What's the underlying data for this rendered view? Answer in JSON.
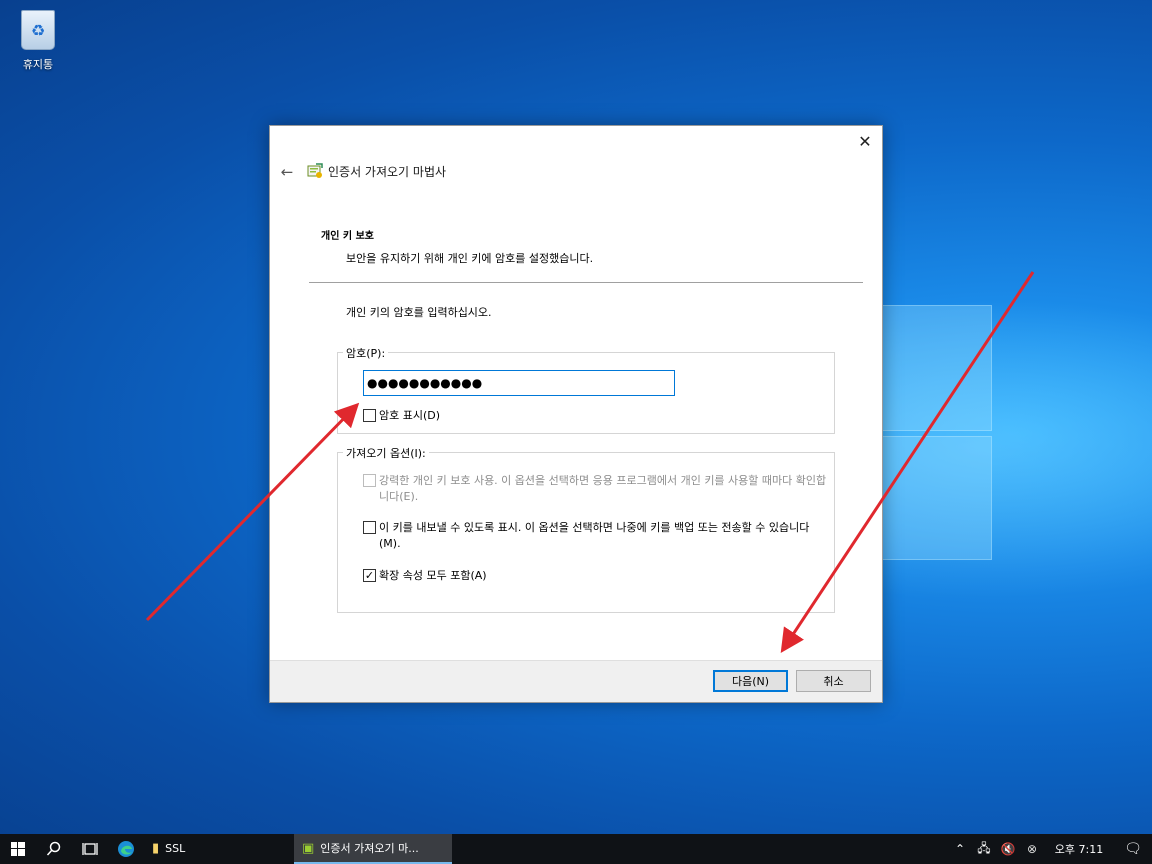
{
  "desktop": {
    "recycle_bin_label": "휴지통"
  },
  "dialog": {
    "wizard_title": "인증서 가져오기 마법사",
    "section_title": "개인 키 보호",
    "section_desc": "보안을 유지하기 위해 개인 키에 암호를 설정했습니다.",
    "instruction": "개인 키의 암호를 입력하십시오.",
    "password_group_label": "암호(P):",
    "password_value": "●●●●●●●●●●●",
    "show_password_label": "암호 표시(D)",
    "options_group_label": "가져오기 옵션(I):",
    "option_strong_label": "강력한 개인 키 보호 사용. 이 옵션을 선택하면 응용 프로그램에서 개인 키를 사용할 때마다 확인합니다(E).",
    "option_strong_checked": false,
    "option_strong_enabled": false,
    "option_exportable_label": "이 키를 내보낼 수 있도록 표시. 이 옵션을 선택하면 나중에 키를 백업 또는 전송할 수 있습니다(M).",
    "option_exportable_checked": false,
    "option_extended_label": "확장 속성 모두 포함(A)",
    "option_extended_checked": true,
    "next_button": "다음(N)",
    "cancel_button": "취소"
  },
  "taskbar": {
    "apps": [
      {
        "label": "SSL",
        "icon": "folder-icon"
      },
      {
        "label": "인증서 가져오기 마...",
        "icon": "certificate-wizard-icon",
        "active": true
      }
    ],
    "clock": "오후 7:11"
  },
  "colors": {
    "accent": "#0078d7",
    "annotation_arrow": "#e0282e"
  }
}
